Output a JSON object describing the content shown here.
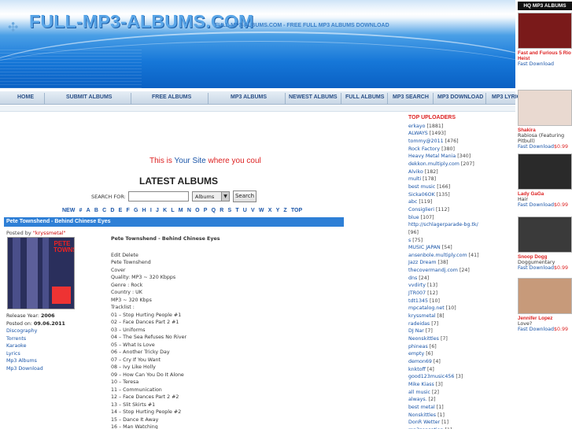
{
  "header": {
    "logo": "FULL-MP3-ALBUMS.COM",
    "tagline": "FULL-MP3-ALBUMS.COM - FREE FULL MP3 ALBUMS DOWNLOAD"
  },
  "nav": [
    "HOME",
    "SUBMIT ALBUMS",
    "FREE ALBUMS",
    "MP3 ALBUMS",
    "NEWEST ALBUMS",
    "FULL ALBUMS",
    "MP3 SEARCH",
    "MP3 DOWNLOAD",
    "MP3 LYRIC"
  ],
  "banner": {
    "a": "This is ",
    "b": "Your Site",
    "c": " where you coul"
  },
  "latest_title": "LATEST ALBUMS",
  "search": {
    "label": "SEARCH FOR:",
    "select": "Albums",
    "button": "Search"
  },
  "alpha": [
    "NEW",
    "#",
    "A",
    "B",
    "C",
    "D",
    "E",
    "F",
    "G",
    "H",
    "I",
    "J",
    "K",
    "L",
    "M",
    "N",
    "O",
    "P",
    "Q",
    "R",
    "S",
    "T",
    "U",
    "V",
    "W",
    "X",
    "Y",
    "Z",
    "TOP"
  ],
  "album": {
    "header": "Pete Townshend - Behind Chinese Eyes",
    "posted_by_label": "Posted by ",
    "posted_by": "\"kryssmetal\"",
    "title": "Pete Townshend - Behind Chinese Eyes",
    "cover_text": "PETE TOWNSHEND",
    "release_label": "Release Year:",
    "release": "2006",
    "posted_on_label": "Posted on:",
    "posted_on": "09.06.2011",
    "links": [
      "Discography",
      "Torrents",
      "Karaoke",
      "Lyrics",
      "Mp3 Albums",
      "Mp3 Download"
    ],
    "details": [
      "Edit Delete",
      "Pete Townshend",
      "Cover",
      "Quality: MP3 ~ 320 Kbpps",
      "Genre : Rock",
      "Country : UK",
      "MP3 ~ 320 Kbps",
      "Tracklist :",
      "01 – Stop Hurting People #1",
      "02 – Face Dances Part 2 #1",
      "03 – Uniforms",
      "04 – The Sea Refuses No River",
      "05 – What Is Love",
      "06 – Another Tricky Day",
      "07 – Cry If You Want",
      "08 – Ivy Like Holly",
      "09 – How Can You Do It Alone",
      "10 – Teresa",
      "11 – Communication",
      "12 – Face Dances Part 2 #2",
      "13 – Slit Skirts #1",
      "14 – Stop Hurting People #2",
      "15 – Dance It Away",
      "16 – Man Watching"
    ]
  },
  "uploaders": {
    "title": "TOP UPLOADERS",
    "items": [
      {
        "name": "erkayo",
        "count": "[1881]"
      },
      {
        "name": "ALWAYS",
        "count": "[1493]"
      },
      {
        "name": "tommy@2011",
        "count": "[476]"
      },
      {
        "name": "Rock Factory",
        "count": "[380]"
      },
      {
        "name": "Heavy Metal Mania",
        "count": "[340]"
      },
      {
        "name": "dekkon.multiply.com",
        "count": "[207]"
      },
      {
        "name": "Alviko",
        "count": "[182]"
      },
      {
        "name": "multi",
        "count": "[178]"
      },
      {
        "name": "best music",
        "count": "[166]"
      },
      {
        "name": "Sicka06OK",
        "count": "[135]"
      },
      {
        "name": "abc",
        "count": "[119]"
      },
      {
        "name": "Consiglieri",
        "count": "[112]"
      },
      {
        "name": "blue",
        "count": "[107]"
      },
      {
        "name": "http://schlagerparade-bg.tk/",
        "count": ""
      },
      {
        "name": "",
        "count": "[96]"
      },
      {
        "name": "s",
        "count": "[75]"
      },
      {
        "name": "MUSIC JAPAN",
        "count": "[54]"
      },
      {
        "name": "ansenbole.multiply.com",
        "count": "[41]"
      },
      {
        "name": "Jazz Dream",
        "count": "[38]"
      },
      {
        "name": "thecovermandj.com",
        "count": "[24]"
      },
      {
        "name": "dns",
        "count": "[24]"
      },
      {
        "name": "vvdirty",
        "count": "[13]"
      },
      {
        "name": "JTR007",
        "count": "[12]"
      },
      {
        "name": "tdt1345",
        "count": "[10]"
      },
      {
        "name": "mpcatalog.net",
        "count": "[10]"
      },
      {
        "name": "kryssmetal",
        "count": "[8]"
      },
      {
        "name": "radeidas",
        "count": "[7]"
      },
      {
        "name": "DJ Nar",
        "count": "[7]"
      },
      {
        "name": "Neonskittles",
        "count": "[7]"
      },
      {
        "name": "phineas",
        "count": "[6]"
      },
      {
        "name": "empty",
        "count": "[6]"
      },
      {
        "name": "demon69",
        "count": "[4]"
      },
      {
        "name": "knktoff",
        "count": "[4]"
      },
      {
        "name": "good123music456",
        "count": "[3]"
      },
      {
        "name": "Mike Kiass",
        "count": "[3]"
      },
      {
        "name": "all music",
        "count": "[2]"
      },
      {
        "name": "always.",
        "count": "[2]"
      },
      {
        "name": "best metal",
        "count": "[1]"
      },
      {
        "name": "Nonskittles",
        "count": "[1]"
      },
      {
        "name": "DonR Wetter",
        "count": "[1]"
      },
      {
        "name": "mp3sensation",
        "count": "[1]"
      }
    ]
  },
  "hq": {
    "title": "HQ MP3 ALBUMS",
    "items": [
      {
        "name": "Fast and Furious 5 Rio Heist",
        "title": "",
        "fd": "Fast Download",
        "price": ""
      },
      {
        "name": "Shakira",
        "title": "Rabiosa (Featuring Pitbull)",
        "fd": "Fast Download",
        "price": "$0.99"
      },
      {
        "name": "Lady GaGa",
        "title": "Hair",
        "fd": "Fast Download",
        "price": "$0.99"
      },
      {
        "name": "Snoop Dogg",
        "title": "Doggumentary",
        "fd": "Fast Download",
        "price": "$0.99"
      },
      {
        "name": "Jennifer Lopez",
        "title": "Love?",
        "fd": "Fast Download",
        "price": "$0.99"
      }
    ],
    "colors": [
      "#7a1a1a",
      "#e9d9d0",
      "#2a2a2a",
      "#3a3a3a",
      "#c79a7a"
    ]
  }
}
